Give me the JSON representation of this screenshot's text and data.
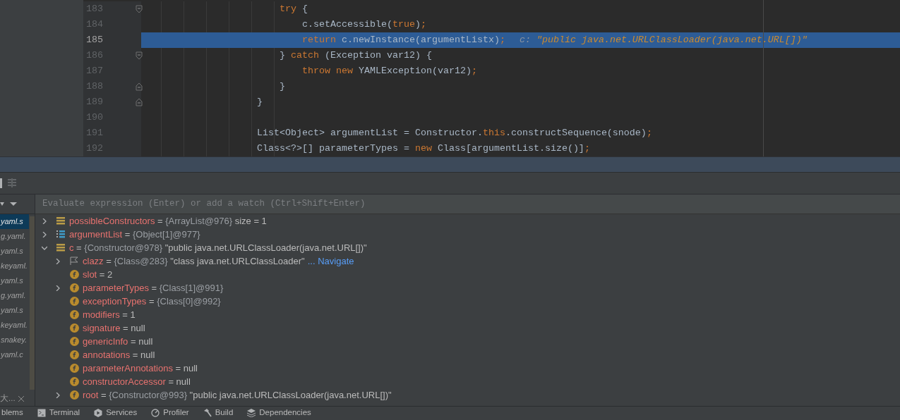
{
  "editor": {
    "lines": [
      {
        "number": "183",
        "kind": "fold_start",
        "selected": false,
        "segments": [
          {
            "kind": "keyword",
            "text": "                        try"
          },
          {
            "kind": "plain",
            "text": " {"
          }
        ]
      },
      {
        "number": "184",
        "selected": false,
        "segments": [
          {
            "kind": "plain",
            "text": "                            c.setAccessible("
          },
          {
            "kind": "keyword",
            "text": "true"
          },
          {
            "kind": "plain",
            "text": ")"
          },
          {
            "kind": "keyword",
            "text": ";"
          }
        ]
      },
      {
        "number": "185",
        "selected": true,
        "segments": [
          {
            "kind": "keyword",
            "text": "                            return"
          },
          {
            "kind": "plain",
            "text": " c.newInstance(argumentListx)"
          },
          {
            "kind": "keyword",
            "text": ";"
          }
        ],
        "hint": {
          "label": "c:",
          "value": "\"public java.net.URLClassLoader(java.net.URL[])\""
        }
      },
      {
        "number": "186",
        "kind": "fold_start",
        "selected": false,
        "segments": [
          {
            "kind": "plain",
            "text": "                        } "
          },
          {
            "kind": "keyword",
            "text": "catch"
          },
          {
            "kind": "plain",
            "text": " (Exception var12) {"
          }
        ]
      },
      {
        "number": "187",
        "selected": false,
        "segments": [
          {
            "kind": "keyword",
            "text": "                            throw new"
          },
          {
            "kind": "plain",
            "text": " YAMLException(var12)"
          },
          {
            "kind": "keyword",
            "text": ";"
          }
        ]
      },
      {
        "number": "188",
        "kind": "fold_end",
        "selected": false,
        "segments": [
          {
            "kind": "plain",
            "text": "                        }"
          }
        ]
      },
      {
        "number": "189",
        "kind": "fold_end",
        "selected": false,
        "segments": [
          {
            "kind": "plain",
            "text": "                    }"
          }
        ]
      },
      {
        "number": "190",
        "selected": false
      },
      {
        "number": "191",
        "selected": false,
        "segments": [
          {
            "kind": "plain",
            "text": "                    List<Object> argumentList = Constructor."
          },
          {
            "kind": "keyword",
            "text": "this"
          },
          {
            "kind": "plain",
            "text": ".constructSequence(snode)"
          },
          {
            "kind": "keyword",
            "text": ";"
          }
        ]
      },
      {
        "number": "192",
        "selected": false,
        "segments": [
          {
            "kind": "plain",
            "text": "                    Class<?>[] parameterTypes = "
          },
          {
            "kind": "keyword",
            "text": "new"
          },
          {
            "kind": "plain",
            "text": " Class[argumentList.size()]"
          },
          {
            "kind": "keyword",
            "text": ";"
          }
        ]
      }
    ]
  },
  "frames": {
    "items": [
      {
        "text": "yaml.s",
        "selected": true
      },
      {
        "text": "g.yaml.",
        "selected": false
      },
      {
        "text": "yaml.s",
        "selected": false
      },
      {
        "text": "keyaml.",
        "selected": false
      },
      {
        "text": "yaml.s",
        "selected": false
      },
      {
        "text": "g.yaml.",
        "selected": false
      },
      {
        "text": "yaml.s",
        "selected": false
      },
      {
        "text": "keyaml.",
        "selected": false
      },
      {
        "text": "snakey.",
        "selected": false
      },
      {
        "text": "yaml.c",
        "selected": false
      }
    ],
    "footer": "大..."
  },
  "watch": {
    "placeholder": "Evaluate expression (Enter) or add a watch (Ctrl+Shift+Enter)"
  },
  "variables": [
    {
      "kind": "list",
      "name": "possibleConstructors",
      "sep": "=",
      "ref": "{ArrayList@976}",
      "value": " size = 1",
      "expanded": false
    },
    {
      "kind": "array",
      "name": "argumentList",
      "sep": "=",
      "ref": "{Object[1]@977}",
      "expanded": false
    },
    {
      "kind": "list",
      "name": "c",
      "sep": "=",
      "ref": "{Constructor@978}",
      "value": "\"public java.net.URLClassLoader(java.net.URL[])\"",
      "expanded": true,
      "children": [
        {
          "kind": "flag",
          "name": "clazz",
          "sep": "=",
          "ref": "{Class@283}",
          "value": "\"class java.net.URLClassLoader\"",
          "link": "... Navigate",
          "expanded": false
        },
        {
          "kind": "field",
          "name": "slot",
          "sep": "=",
          "value": "2"
        },
        {
          "kind": "field",
          "name": "parameterTypes",
          "sep": "=",
          "ref": "{Class[1]@991}",
          "expanded": false
        },
        {
          "kind": "field",
          "name": "exceptionTypes",
          "sep": "=",
          "ref": "{Class[0]@992}"
        },
        {
          "kind": "field",
          "name": "modifiers",
          "sep": "=",
          "value": "1"
        },
        {
          "kind": "field",
          "name": "signature",
          "sep": "=",
          "value": "null"
        },
        {
          "kind": "field",
          "name": "genericInfo",
          "sep": "=",
          "value": "null"
        },
        {
          "kind": "field",
          "name": "annotations",
          "sep": "=",
          "value": "null"
        },
        {
          "kind": "field",
          "name": "parameterAnnotations",
          "sep": "=",
          "value": "null"
        },
        {
          "kind": "field",
          "name": "constructorAccessor",
          "sep": "=",
          "value": "null"
        },
        {
          "kind": "field",
          "name": "root",
          "sep": "=",
          "ref": "{Constructor@993}",
          "value": "\"public java.net.URLClassLoader(java.net.URL[])\"",
          "expanded": false
        }
      ]
    }
  ],
  "bottom_tabs": [
    {
      "label": "blems"
    },
    {
      "label": "Terminal"
    },
    {
      "label": "Services"
    },
    {
      "label": "Profiler"
    },
    {
      "label": "Build"
    },
    {
      "label": "Dependencies"
    }
  ]
}
